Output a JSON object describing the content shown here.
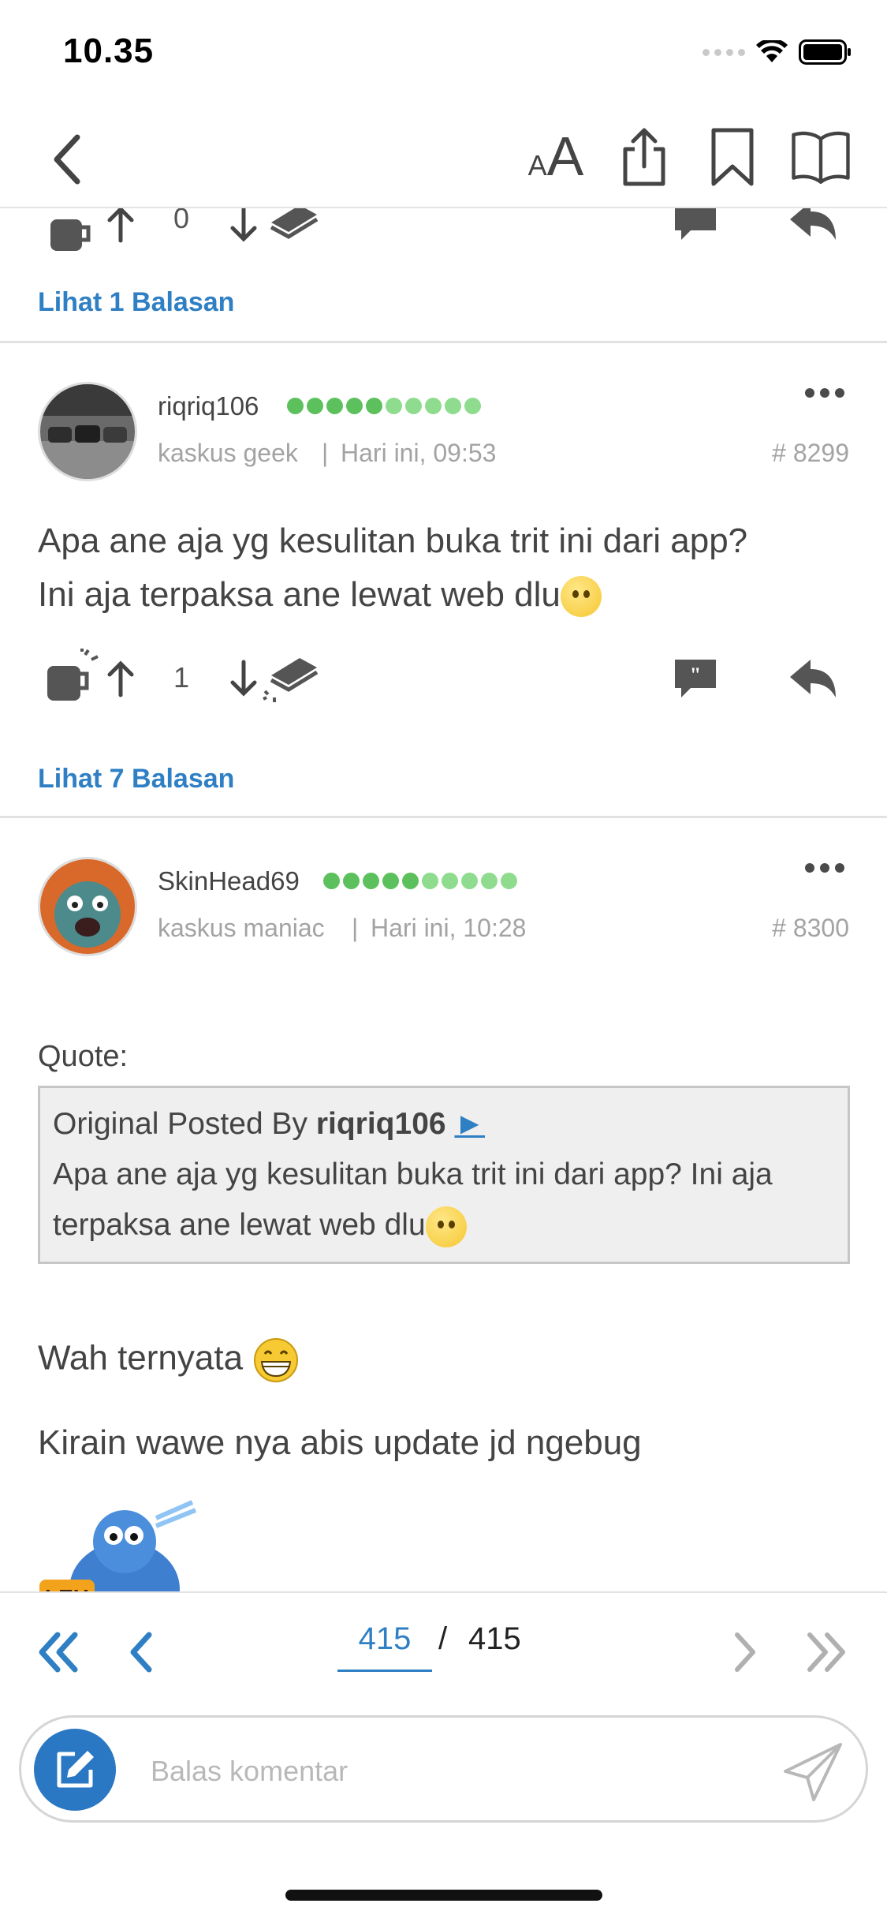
{
  "status_bar": {
    "time": "10.35"
  },
  "header": {
    "back_label": "back",
    "font_small": "A",
    "font_big": "A"
  },
  "prev_post": {
    "vote_count": "0",
    "replies_label": "Lihat 1 Balasan"
  },
  "posts": [
    {
      "username": "riqriq106",
      "rank": "kaskus geek",
      "separator": "|",
      "time": "Hari ini, 09:53",
      "number": "# 8299",
      "body_line1": "Apa ane aja yg kesulitan buka trit ini dari app?",
      "body_line2": "Ini aja terpaksa ane lewat web dlu",
      "vote_count": "1",
      "replies_label": "Lihat 7 Balasan",
      "reputation_colors": [
        "#5cc15c",
        "#5cc15c",
        "#5cc15c",
        "#5cc15c",
        "#5cc15c",
        "#8fdc8f",
        "#8fdc8f",
        "#8fdc8f",
        "#8fdc8f",
        "#8fdc8f"
      ]
    },
    {
      "username": "SkinHead69",
      "rank": "kaskus maniac",
      "separator": "|",
      "time": "Hari ini, 10:28",
      "number": "# 8300",
      "quote_label": "Quote:",
      "quote_prefix": "Original Posted By ",
      "quote_author": "riqriq106",
      "quote_arrow": "►",
      "quote_text": "Apa ane aja yg kesulitan buka trit ini dari app? Ini aja terpaksa ane lewat web dlu",
      "line1": "Wah ternyata",
      "line2": "Kirain wawe nya abis update jd ngebug",
      "sticker_text": "LEH",
      "reputation_colors": [
        "#5cc15c",
        "#5cc15c",
        "#5cc15c",
        "#5cc15c",
        "#5cc15c",
        "#8fdc8f",
        "#8fdc8f",
        "#8fdc8f",
        "#8fdc8f",
        "#8fdc8f"
      ]
    }
  ],
  "pager": {
    "current": "415",
    "separator": "/",
    "total": "415"
  },
  "reply": {
    "placeholder": "Balas komentar"
  },
  "colors": {
    "accent": "#2f7fc4",
    "compose_bg": "#2a78c3"
  }
}
